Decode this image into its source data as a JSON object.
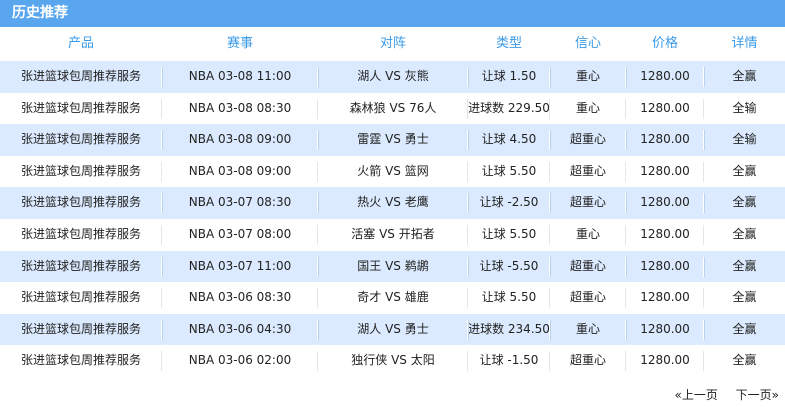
{
  "panel": {
    "title": "历史推荐"
  },
  "columns": [
    "产品",
    "赛事",
    "对阵",
    "类型",
    "信心",
    "价格",
    "详情"
  ],
  "rows": [
    [
      "张进篮球包周推荐服务",
      "NBA 03-08 11:00",
      "湖人 VS 灰熊",
      "让球 1.50",
      "重心",
      "1280.00",
      "全赢"
    ],
    [
      "张进篮球包周推荐服务",
      "NBA 03-08 08:30",
      "森林狼 VS 76人",
      "进球数 229.50",
      "重心",
      "1280.00",
      "全输"
    ],
    [
      "张进篮球包周推荐服务",
      "NBA 03-08 09:00",
      "雷霆 VS 勇士",
      "让球 4.50",
      "超重心",
      "1280.00",
      "全输"
    ],
    [
      "张进篮球包周推荐服务",
      "NBA 03-08 09:00",
      "火箭 VS 篮网",
      "让球 5.50",
      "超重心",
      "1280.00",
      "全赢"
    ],
    [
      "张进篮球包周推荐服务",
      "NBA 03-07 08:30",
      "热火 VS 老鹰",
      "让球 -2.50",
      "超重心",
      "1280.00",
      "全赢"
    ],
    [
      "张进篮球包周推荐服务",
      "NBA 03-07 08:00",
      "活塞 VS 开拓者",
      "让球 5.50",
      "重心",
      "1280.00",
      "全赢"
    ],
    [
      "张进篮球包周推荐服务",
      "NBA 03-07 11:00",
      "国王 VS 鹈鹕",
      "让球 -5.50",
      "超重心",
      "1280.00",
      "全赢"
    ],
    [
      "张进篮球包周推荐服务",
      "NBA 03-06 08:30",
      "奇才 VS 雄鹿",
      "让球 5.50",
      "超重心",
      "1280.00",
      "全赢"
    ],
    [
      "张进篮球包周推荐服务",
      "NBA 03-06 04:30",
      "湖人 VS 勇士",
      "进球数 234.50",
      "重心",
      "1280.00",
      "全赢"
    ],
    [
      "张进篮球包周推荐服务",
      "NBA 03-06 02:00",
      "独行侠 VS 太阳",
      "让球 -1.50",
      "超重心",
      "1280.00",
      "全赢"
    ]
  ],
  "pager": {
    "prev_label": "«上一页",
    "next_label": "下一页»"
  },
  "colors": {
    "header_bg": "#5aa6ee",
    "column_header_text": "#3b9be8",
    "stripe_bg": "#dbeafe"
  }
}
